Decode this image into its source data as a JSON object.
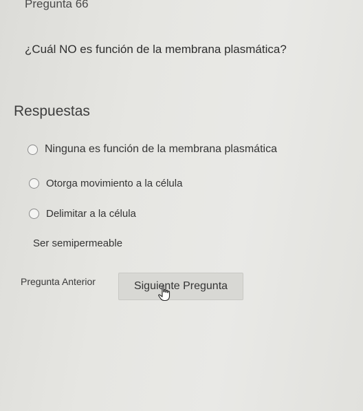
{
  "question": {
    "number_label": "Pregunta 66",
    "text": "¿Cuál NO es función de la membrana plasmática?"
  },
  "answers": {
    "heading": "Respuestas",
    "options": [
      {
        "label": "Ninguna es función de la membrana plasmática"
      },
      {
        "label": "Otorga movimiento a la célula"
      },
      {
        "label": "Delimitar a la célula"
      },
      {
        "label": "Ser semipermeable"
      }
    ]
  },
  "navigation": {
    "previous_label": "Pregunta Anterior",
    "next_label": "Siguiente Pregunta"
  },
  "cursor": {
    "icon": "hand-pointer-icon"
  }
}
